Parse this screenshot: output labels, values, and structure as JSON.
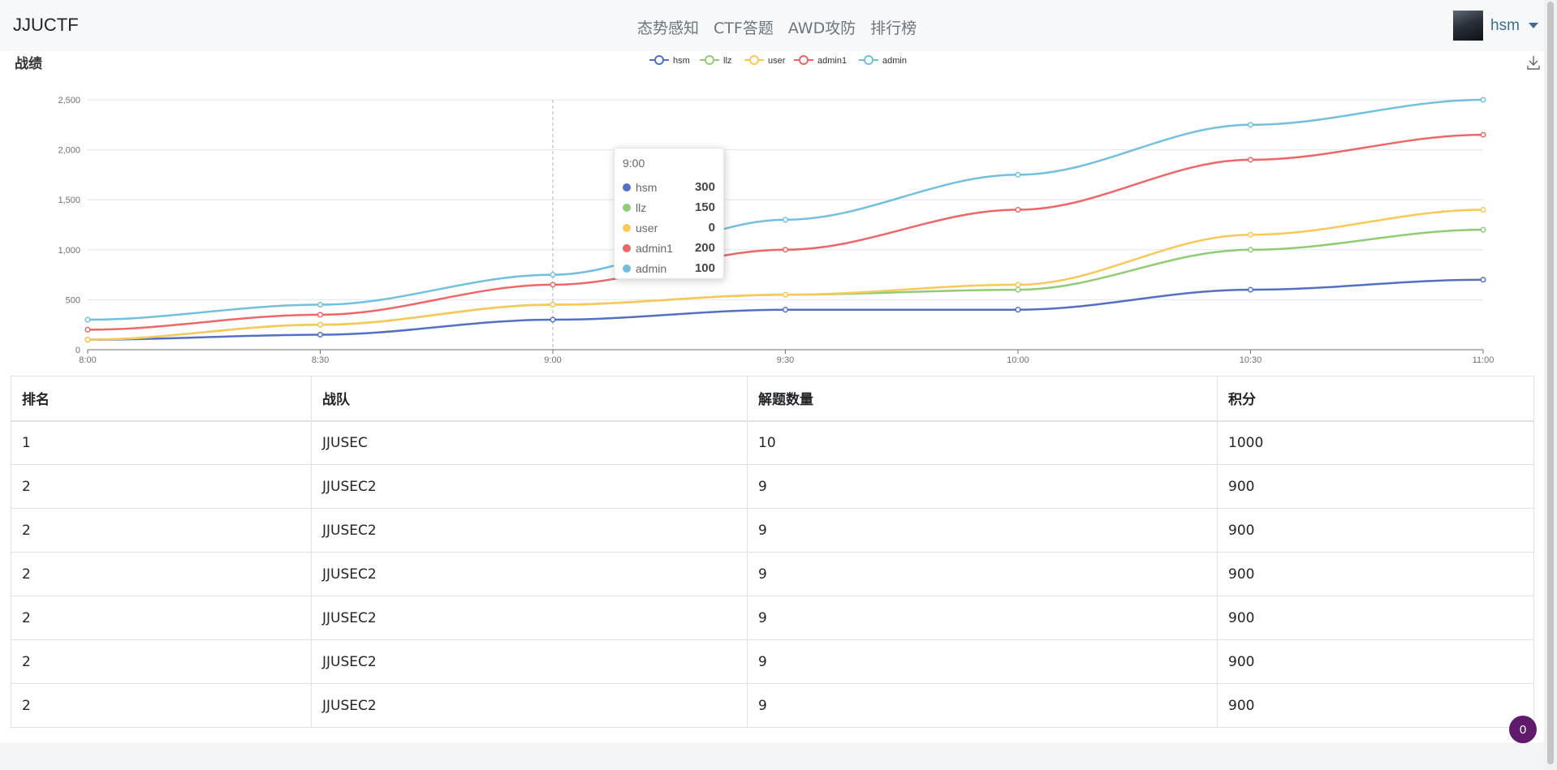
{
  "navbar": {
    "brand": "JJUCTF",
    "links": [
      "态势感知",
      "CTF答题",
      "AWD攻防",
      "排行榜"
    ],
    "user": "hsm"
  },
  "chart_title": "战绩",
  "chart_data": {
    "type": "line",
    "title": "战绩",
    "categories": [
      "8:00",
      "8:30",
      "9:00",
      "9:30",
      "10:00",
      "10:30",
      "11:00"
    ],
    "series": [
      {
        "name": "hsm",
        "color": "#5470c6",
        "values": [
          100,
          150,
          300,
          400,
          400,
          600,
          700
        ]
      },
      {
        "name": "llz",
        "color": "#91cc75",
        "values": [
          100,
          250,
          450,
          550,
          600,
          1000,
          1200
        ]
      },
      {
        "name": "user",
        "color": "#fac858",
        "values": [
          100,
          250,
          450,
          550,
          650,
          1150,
          1400
        ]
      },
      {
        "name": "admin1",
        "color": "#ee6666",
        "values": [
          200,
          350,
          650,
          1000,
          1400,
          1900,
          2150
        ]
      },
      {
        "name": "admin",
        "color": "#73c0de",
        "values": [
          300,
          450,
          750,
          1300,
          1750,
          2250,
          2500
        ]
      }
    ],
    "ylim": [
      0,
      2500
    ],
    "yticks": [
      "0",
      "500",
      "1,000",
      "1,500",
      "2,000",
      "2,500"
    ],
    "grid": true,
    "legend": "top-center"
  },
  "tooltip": {
    "title": "9:00",
    "rows": [
      {
        "name": "hsm",
        "value": "300",
        "color": "#5470c6"
      },
      {
        "name": "llz",
        "value": "150",
        "color": "#91cc75"
      },
      {
        "name": "user",
        "value": "0",
        "color": "#fac858"
      },
      {
        "name": "admin1",
        "value": "200",
        "color": "#ee6666"
      },
      {
        "name": "admin",
        "value": "100",
        "color": "#73c0de"
      }
    ]
  },
  "table": {
    "headers": [
      "排名",
      "战队",
      "解题数量",
      "积分"
    ],
    "rows": [
      [
        "1",
        "JJUSEC",
        "10",
        "1000"
      ],
      [
        "2",
        "JJUSEC2",
        "9",
        "900"
      ],
      [
        "2",
        "JJUSEC2",
        "9",
        "900"
      ],
      [
        "2",
        "JJUSEC2",
        "9",
        "900"
      ],
      [
        "2",
        "JJUSEC2",
        "9",
        "900"
      ],
      [
        "2",
        "JJUSEC2",
        "9",
        "900"
      ],
      [
        "2",
        "JJUSEC2",
        "9",
        "900"
      ]
    ]
  },
  "badge_count": "0"
}
